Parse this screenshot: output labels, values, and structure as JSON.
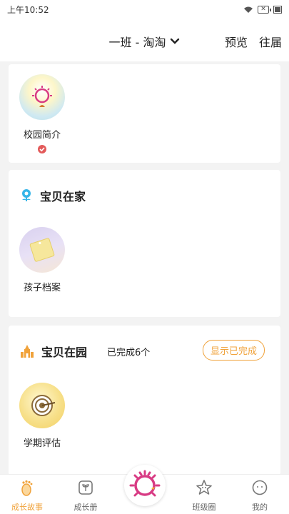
{
  "status": {
    "time": "上午10:52"
  },
  "nav": {
    "title": "一班 - 淘淘",
    "preview": "预览",
    "past": "往届"
  },
  "card1": {
    "tile_label": "校园简介"
  },
  "card2": {
    "title": "宝贝在家",
    "tile_label": "孩子档案"
  },
  "card3": {
    "title": "宝贝在园",
    "subtitle": "已完成6个",
    "button": "显示已完成",
    "tile_label": "学期评估"
  },
  "tabs": [
    {
      "label": "成长故事",
      "icon": "footprint-icon",
      "active": true
    },
    {
      "label": "成长册",
      "icon": "sprout-book-icon",
      "active": false
    },
    {
      "label": "",
      "icon": "sun-logo-icon",
      "active": false
    },
    {
      "label": "班级圈",
      "icon": "star-face-icon",
      "active": false
    },
    {
      "label": "我的",
      "icon": "face-icon",
      "active": false
    }
  ],
  "colors": {
    "accent": "#f0a23a",
    "verify": "#e35a5a"
  }
}
